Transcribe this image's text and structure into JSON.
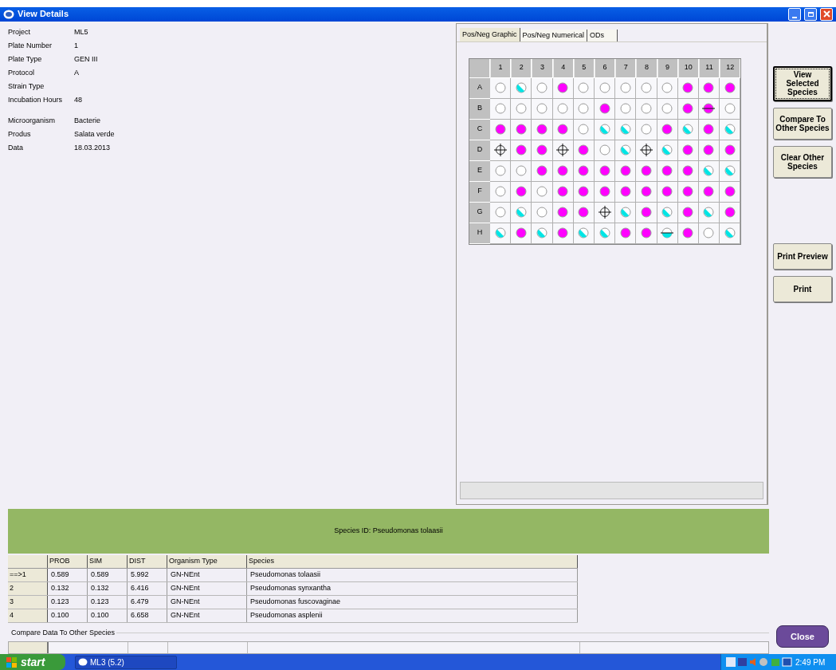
{
  "window": {
    "title": "View Details"
  },
  "details": [
    {
      "label": "Project",
      "value": "ML5"
    },
    {
      "label": "Plate Number",
      "value": "1"
    },
    {
      "label": "Plate Type",
      "value": "GEN III"
    },
    {
      "label": "Protocol",
      "value": "A"
    },
    {
      "label": "Strain Type"
    },
    {
      "label": "Incubation Hours",
      "value": "48"
    }
  ],
  "sample_details": [
    {
      "label": "Microorganism",
      "value": "Bacterie"
    },
    {
      "label": "Produs",
      "value": "Salata verde"
    },
    {
      "label": "Data",
      "value": "18.03.2013"
    }
  ],
  "plate": {
    "tabs": [
      {
        "label": "Pos/Neg Graphic",
        "selected": true
      },
      {
        "label": "Pos/Neg Numerical",
        "selected": false
      },
      {
        "label": "ODs",
        "selected": false
      }
    ],
    "columns": [
      "1",
      "2",
      "3",
      "4",
      "5",
      "6",
      "7",
      "8",
      "9",
      "10",
      "11",
      "12"
    ],
    "rows": [
      {
        "label": "A",
        "wells": [
          {
            "kind": "neg"
          },
          {
            "kind": "bord"
          },
          {
            "kind": "neg"
          },
          {
            "kind": "pos"
          },
          {
            "kind": "neg"
          },
          {
            "kind": "neg"
          },
          {
            "kind": "neg"
          },
          {
            "kind": "neg"
          },
          {
            "kind": "neg"
          },
          {
            "kind": "pos"
          },
          {
            "kind": "pos"
          },
          {
            "kind": "pos"
          }
        ]
      },
      {
        "label": "B",
        "wells": [
          {
            "kind": "neg"
          },
          {
            "kind": "neg"
          },
          {
            "kind": "neg"
          },
          {
            "kind": "neg"
          },
          {
            "kind": "neg"
          },
          {
            "kind": "pos"
          },
          {
            "kind": "neg"
          },
          {
            "kind": "neg"
          },
          {
            "kind": "neg"
          },
          {
            "kind": "pos"
          },
          {
            "kind": "posline"
          },
          {
            "kind": "neg"
          }
        ]
      },
      {
        "label": "C",
        "wells": [
          {
            "kind": "pos"
          },
          {
            "kind": "pos"
          },
          {
            "kind": "pos"
          },
          {
            "kind": "pos"
          },
          {
            "kind": "neg"
          },
          {
            "kind": "bord"
          },
          {
            "kind": "bord"
          },
          {
            "kind": "neg"
          },
          {
            "kind": "pos"
          },
          {
            "kind": "bord"
          },
          {
            "kind": "pos"
          },
          {
            "kind": "bord"
          }
        ]
      },
      {
        "label": "D",
        "wells": [
          {
            "kind": "cross"
          },
          {
            "kind": "pos"
          },
          {
            "kind": "pos"
          },
          {
            "kind": "cross"
          },
          {
            "kind": "pos"
          },
          {
            "kind": "neg"
          },
          {
            "kind": "bord"
          },
          {
            "kind": "cross"
          },
          {
            "kind": "bord"
          },
          {
            "kind": "pos"
          },
          {
            "kind": "pos"
          },
          {
            "kind": "pos"
          }
        ]
      },
      {
        "label": "E",
        "wells": [
          {
            "kind": "neg"
          },
          {
            "kind": "neg"
          },
          {
            "kind": "pos"
          },
          {
            "kind": "pos"
          },
          {
            "kind": "pos"
          },
          {
            "kind": "pos"
          },
          {
            "kind": "pos"
          },
          {
            "kind": "pos"
          },
          {
            "kind": "pos"
          },
          {
            "kind": "pos"
          },
          {
            "kind": "bord"
          },
          {
            "kind": "bord"
          }
        ]
      },
      {
        "label": "F",
        "wells": [
          {
            "kind": "neg"
          },
          {
            "kind": "pos"
          },
          {
            "kind": "neg"
          },
          {
            "kind": "pos"
          },
          {
            "kind": "pos"
          },
          {
            "kind": "pos"
          },
          {
            "kind": "pos"
          },
          {
            "kind": "pos"
          },
          {
            "kind": "pos"
          },
          {
            "kind": "pos"
          },
          {
            "kind": "pos"
          },
          {
            "kind": "pos"
          }
        ]
      },
      {
        "label": "G",
        "wells": [
          {
            "kind": "neg"
          },
          {
            "kind": "bord"
          },
          {
            "kind": "neg"
          },
          {
            "kind": "pos"
          },
          {
            "kind": "pos"
          },
          {
            "kind": "cross"
          },
          {
            "kind": "bord"
          },
          {
            "kind": "pos"
          },
          {
            "kind": "bord"
          },
          {
            "kind": "pos"
          },
          {
            "kind": "bord"
          },
          {
            "kind": "pos"
          }
        ]
      },
      {
        "label": "H",
        "wells": [
          {
            "kind": "bord"
          },
          {
            "kind": "pos"
          },
          {
            "kind": "bord"
          },
          {
            "kind": "pos"
          },
          {
            "kind": "bord"
          },
          {
            "kind": "bord"
          },
          {
            "kind": "pos"
          },
          {
            "kind": "pos"
          },
          {
            "kind": "bordline"
          },
          {
            "kind": "pos"
          },
          {
            "kind": "neg"
          },
          {
            "kind": "bord"
          }
        ]
      }
    ]
  },
  "banner": "Species ID: Pseudomonas tolaasii",
  "results": {
    "columns": [
      "PROB",
      "SIM",
      "DIST",
      "Organism Type",
      "Species"
    ],
    "rows": [
      {
        "rank": "==>1",
        "cells": [
          "0.589",
          "0.589",
          "5.992",
          "GN-NEnt",
          "Pseudomonas tolaasii"
        ]
      },
      {
        "rank": "2",
        "cells": [
          "0.132",
          "0.132",
          "6.416",
          "GN-NEnt",
          "Pseudomonas synxantha"
        ]
      },
      {
        "rank": "3",
        "cells": [
          "0.123",
          "0.123",
          "6.479",
          "GN-NEnt",
          "Pseudomonas fuscovaginae"
        ]
      },
      {
        "rank": "4",
        "cells": [
          "0.100",
          "0.100",
          "6.658",
          "GN-NEnt",
          "Pseudomonas asplenii"
        ]
      }
    ]
  },
  "compare_section": "Compare Data To Other Species",
  "side_buttons": [
    {
      "label": "View Selected Species",
      "focused": true
    },
    {
      "label": "Compare To Other Species",
      "focused": false
    },
    {
      "label": "Clear Other Species",
      "focused": false
    }
  ],
  "print_buttons": [
    "Print Preview",
    "Print"
  ],
  "close_button": "Close",
  "taskbar": {
    "start": "start",
    "tasks": [
      "ML3 (5.2)"
    ],
    "clock": "2:49 PM"
  }
}
